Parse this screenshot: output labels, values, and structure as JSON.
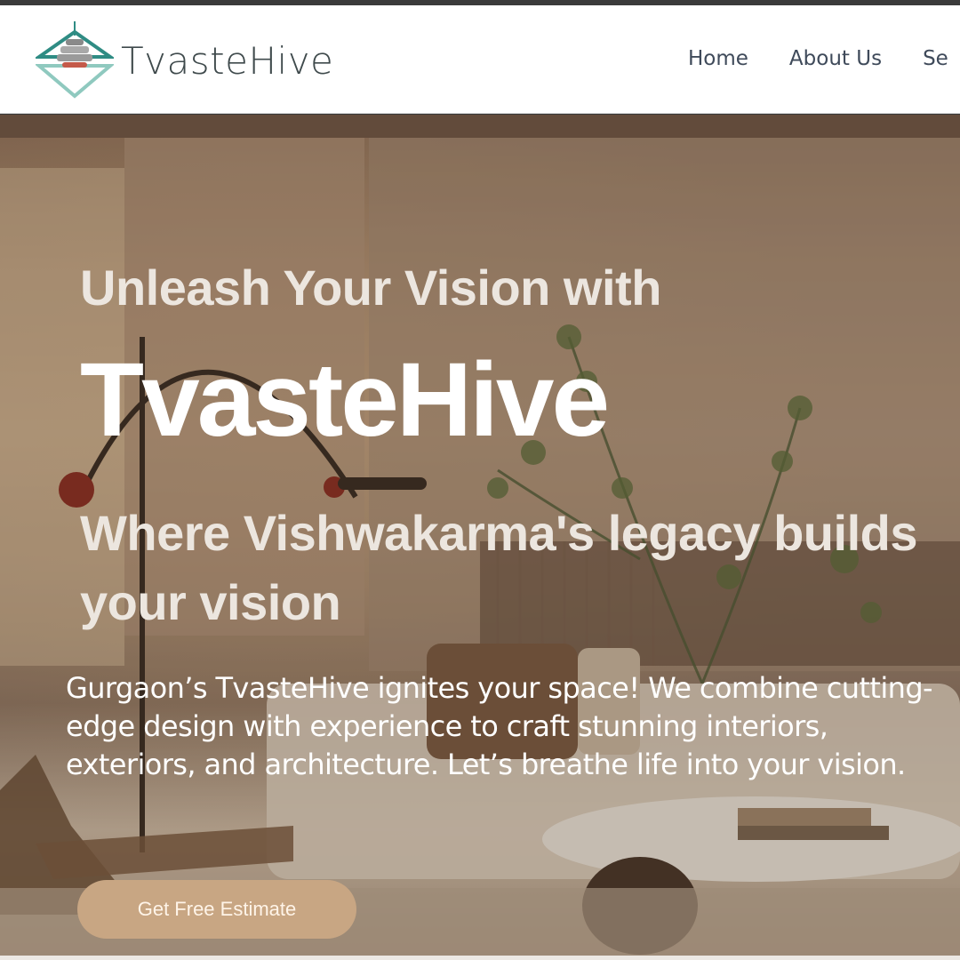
{
  "header": {
    "logo_text": "TvasteHive",
    "nav": [
      "Home",
      "About Us",
      "Se"
    ]
  },
  "hero": {
    "title_line1": "Unleash Your Vision with",
    "title_brand": "TvasteHive",
    "title_line3": "Where Vishwakarma's legacy builds your vision",
    "description": "Gurgaon’s TvasteHive ignites your space! We combine cutting-edge design with experience to craft stunning interiors, exteriors, and architecture. Let’s breathe life into your vision.",
    "cta_label": "Get Free Estimate"
  },
  "colors": {
    "accent": "#c8a683",
    "logo_teal": "#2f8c84",
    "nav_text": "#3f4a5a"
  }
}
